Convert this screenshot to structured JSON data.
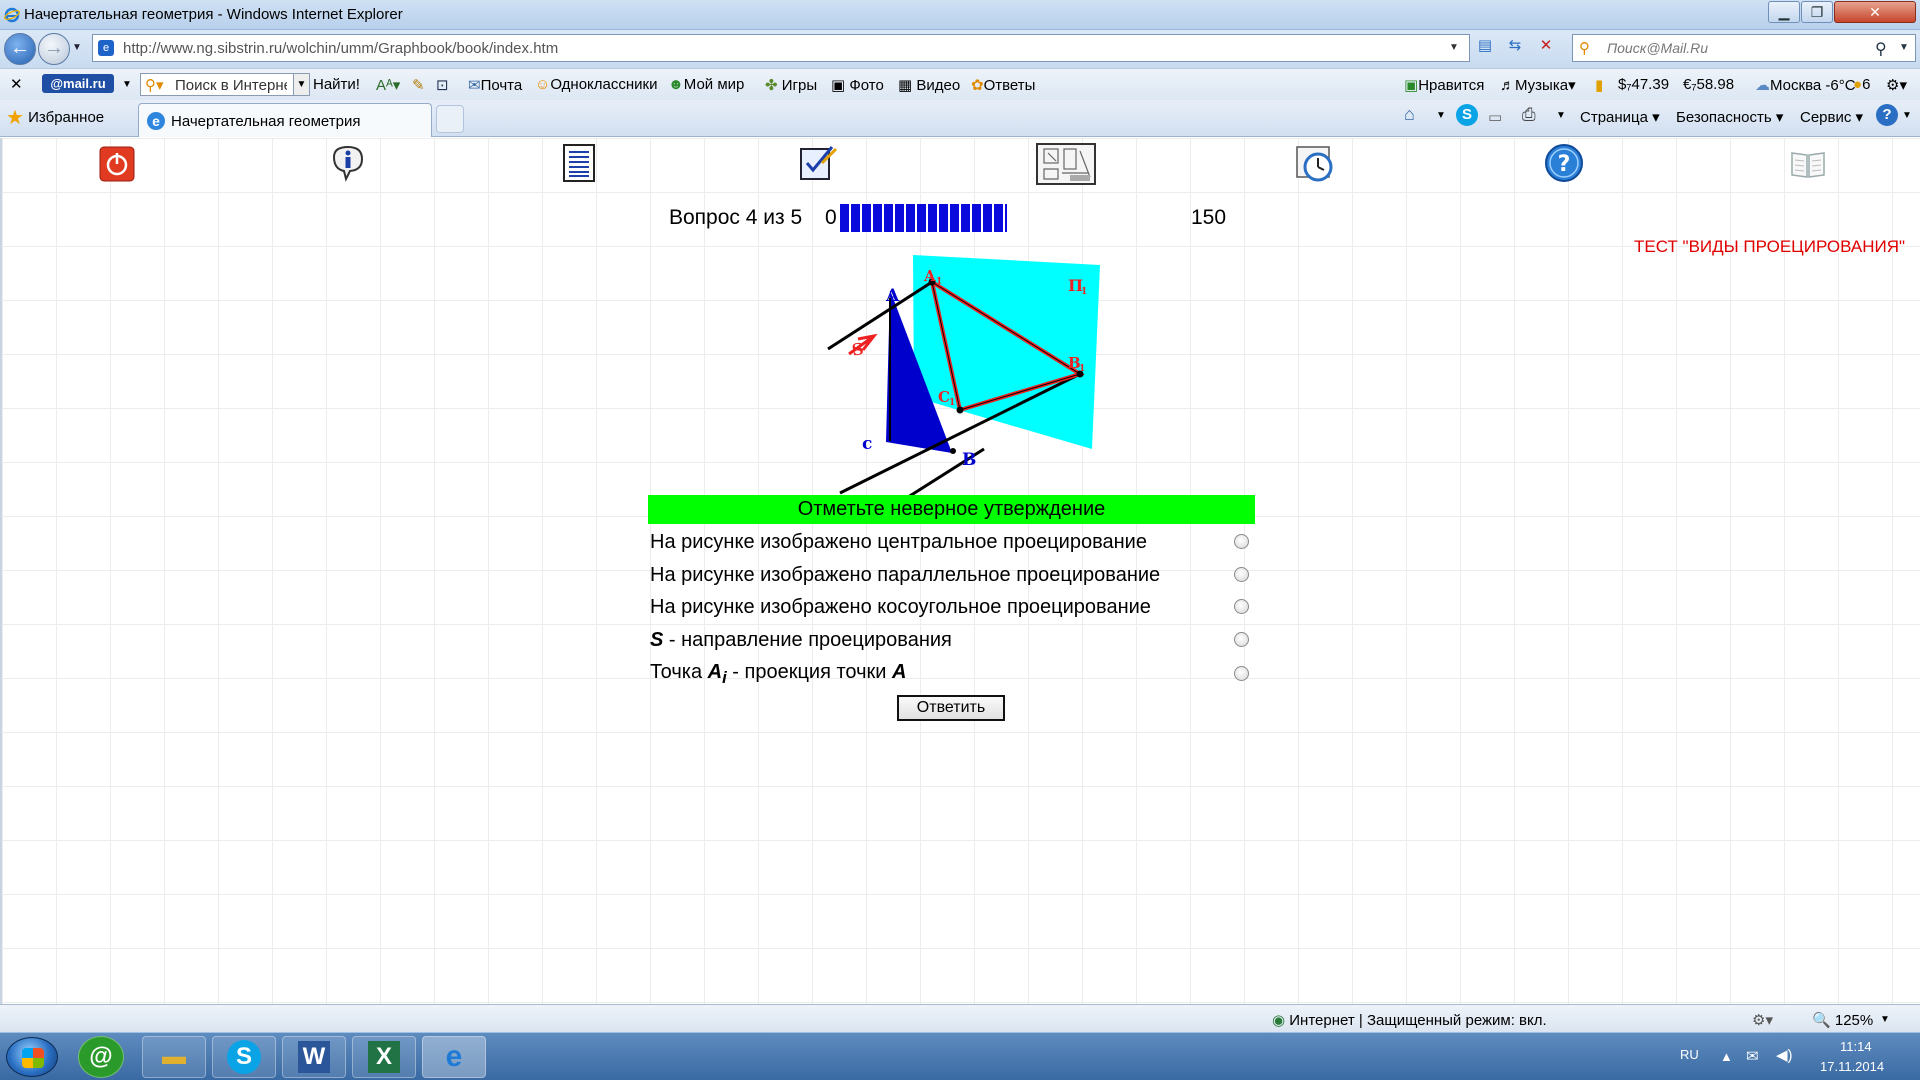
{
  "window": {
    "title": "Начертательная геометрия - Windows Internet Explorer",
    "address": "http://www.ng.sibstrin.ru/wolchin/umm/Graphbook/book/index.htm",
    "search_placeholder": "Поиск@Mail.Ru"
  },
  "mailbar": {
    "logo": "@mail.ru",
    "search_placeholder": "Поиск в Интернете",
    "find": "Найти!",
    "items": [
      "Почта",
      "Одноклассники",
      "Мой мир",
      "Игры",
      "Фото",
      "Видео",
      "Ответы"
    ],
    "right": {
      "like": "Нравится",
      "music": "Музыка",
      "usd": "$₇47.39",
      "eur": "€₇58.98",
      "weather": "Москва -6°C",
      "count": "6"
    }
  },
  "tabs": {
    "favorites": "Избранное",
    "active_tab": "Начертательная геометрия"
  },
  "commands": {
    "page": "Страница",
    "safety": "Безопасность",
    "service": "Сервис"
  },
  "toolbar_icons": [
    "power-icon",
    "info-icon",
    "document-icon",
    "checklist-icon",
    "drawing-icon",
    "timer-icon",
    "help-icon",
    "book-icon"
  ],
  "test": {
    "counter": "Вопрос 4 из 5",
    "progress_min": "0",
    "progress_max": "150",
    "progress_fraction": 0.93,
    "title": "ТЕСТ \"ВИДЫ ПРОЕЦИРОВАНИЯ\"",
    "question": "Отметьте неверное утверждение",
    "options": [
      {
        "text": "На рисунке изображено центральное проецирование"
      },
      {
        "text": "На рисунке изображено параллельное проецирование"
      },
      {
        "text": "На рисунке изображено косоугольное проецирование"
      },
      {
        "prefix": "S",
        "text": " - направление проецирования"
      },
      {
        "prefix": "Точка ",
        "sym": "A",
        "sub": "i",
        "mid": " - проекция точки ",
        "sym2": "A"
      }
    ],
    "answer_button": "Ответить"
  },
  "figure": {
    "labels": {
      "a": "A",
      "a1": "A",
      "b": "B",
      "b1": "B",
      "c": "c",
      "c1": "C",
      "plane": "П",
      "s": "S",
      "one": "1"
    },
    "colors": {
      "plane": "#00ffff",
      "triangle": "#0000cc",
      "projection": "#ee2222",
      "rays": "#000000"
    }
  },
  "status": {
    "zone": "Интернет | Защищенный режим: вкл.",
    "zoom": "125%"
  },
  "taskbar": {
    "lang": "RU",
    "time": "11:14",
    "date": "17.11.2014"
  }
}
